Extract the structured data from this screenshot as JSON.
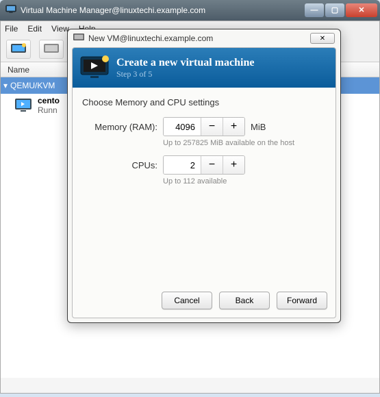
{
  "window": {
    "title": "Virtual Machine Manager@linuxtechi.example.com"
  },
  "menubar": {
    "file": "File",
    "edit": "Edit",
    "view": "View",
    "help": "Help"
  },
  "list": {
    "header_name": "Name",
    "group": "QEMU/KVM",
    "vm_name": "cento",
    "vm_status": "Runn"
  },
  "dialog": {
    "title": "New VM@linuxtechi.example.com",
    "banner_title": "Create a new virtual machine",
    "banner_step": "Step 3 of 5",
    "body_heading": "Choose Memory and CPU settings",
    "mem_label": "Memory (RAM):",
    "mem_value": "4096",
    "mem_unit": "MiB",
    "mem_hint": "Up to 257825 MiB available on the host",
    "cpu_label": "CPUs:",
    "cpu_value": "2",
    "cpu_hint": "Up to 112 available",
    "buttons": {
      "cancel": "Cancel",
      "back": "Back",
      "forward": "Forward"
    }
  }
}
